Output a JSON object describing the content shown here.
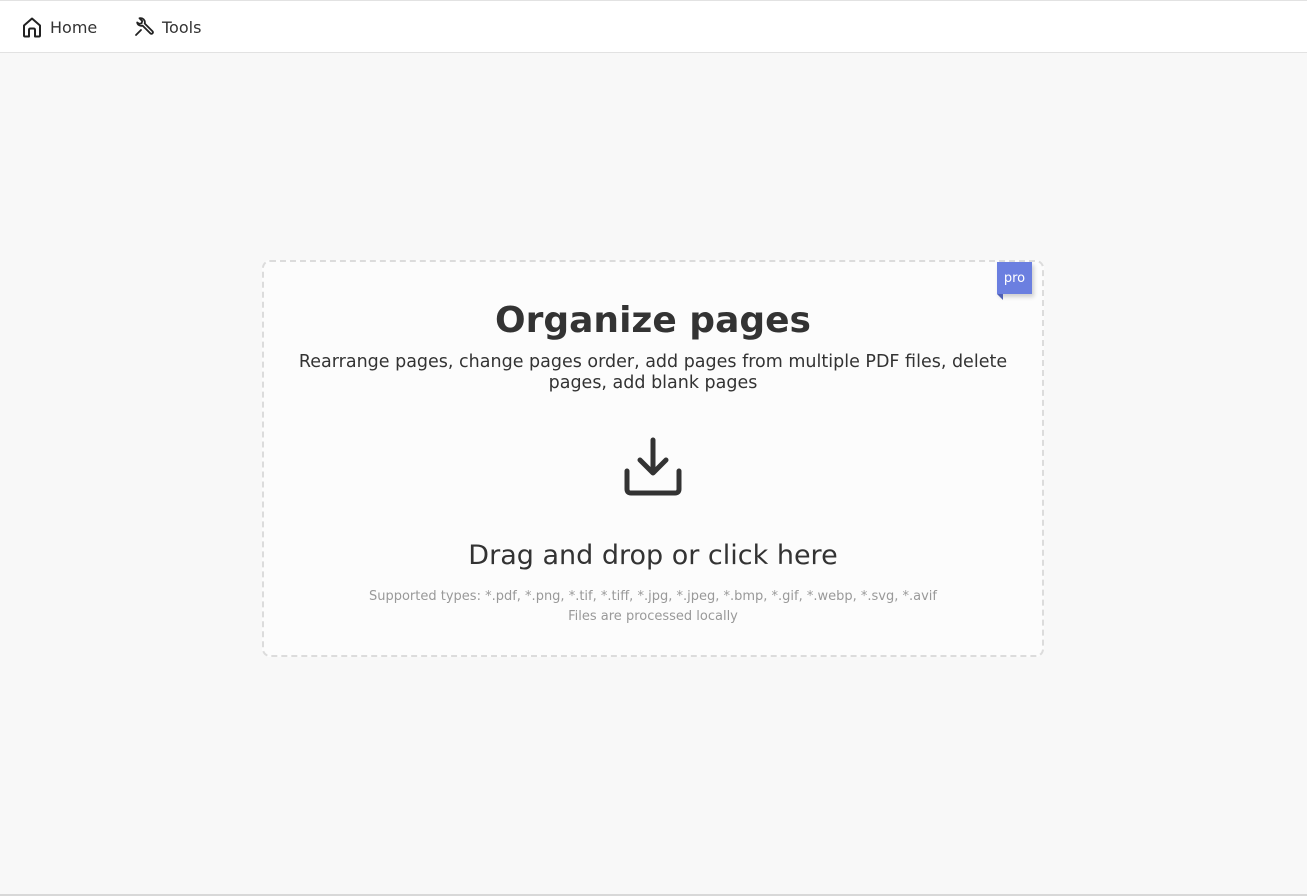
{
  "nav": {
    "home_label": "Home",
    "home_icon": "home-icon",
    "tools_label": "Tools",
    "tools_icon": "wrench-icon"
  },
  "dropzone": {
    "badge": "pro",
    "badge_color": "#6b7fe0",
    "title": "Organize pages",
    "subtitle": "Rearrange pages, change pages order, add pages from multiple PDF files, delete pages, add blank pages",
    "icon": "download-tray-icon",
    "cta": "Drag and drop or click here",
    "supported_types": "Supported types: *.pdf, *.png, *.tif, *.tiff, *.jpg, *.jpeg, *.bmp, *.gif, *.webp, *.svg, *.avif",
    "local_note": "Files are processed locally"
  }
}
